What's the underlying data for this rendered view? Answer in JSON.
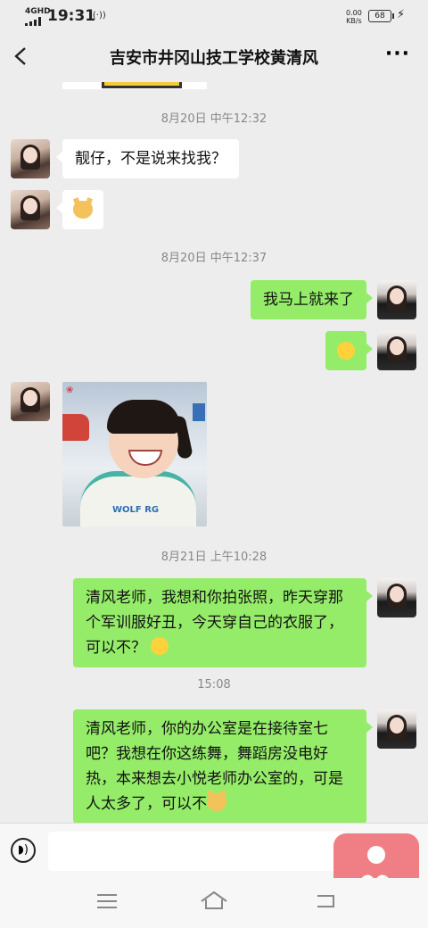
{
  "status_bar": {
    "network": "4GHD",
    "time": "19:31",
    "speed_value": "0.00",
    "speed_unit": "KB/s",
    "battery": "68"
  },
  "header": {
    "title": "吉安市井冈山技工学校黄清风",
    "more": "···"
  },
  "timestamps": [
    "8月20日 中午12:32",
    "8月20日 中午12:37",
    "8月21日 上午10:28",
    "15:08"
  ],
  "messages": [
    {
      "side": "left",
      "text": "靓仔，不是说来找我？"
    },
    {
      "side": "left",
      "sticker": "dog-emoji"
    },
    {
      "side": "right",
      "text": "我马上就来了"
    },
    {
      "side": "right",
      "emoji": "grin-emoji"
    },
    {
      "side": "left",
      "image": "smiling-girl-photo",
      "image_text": "WOLF RG"
    },
    {
      "side": "right",
      "text": "清风老师，我想和你拍张照，昨天穿那个军训服好丑，今天穿自己的衣服了，可以不？"
    },
    {
      "side": "right",
      "text": "清风老师，你的办公室是在接待室七吧？我想在你这练舞，舞蹈房没电好热，本来想去小悦老师办公室的，可是人太多了，可以不"
    }
  ],
  "icons": {
    "back": "chevron-left-icon",
    "voice": "voice-icon",
    "menu": "menu-icon",
    "home": "home-icon",
    "return": "back-arrow-icon",
    "floating": "heart-person-icon"
  },
  "colors": {
    "bg": "#ededed",
    "bubble_green": "#95ec69",
    "bubble_white": "#ffffff",
    "float_pink": "#f07f85"
  }
}
